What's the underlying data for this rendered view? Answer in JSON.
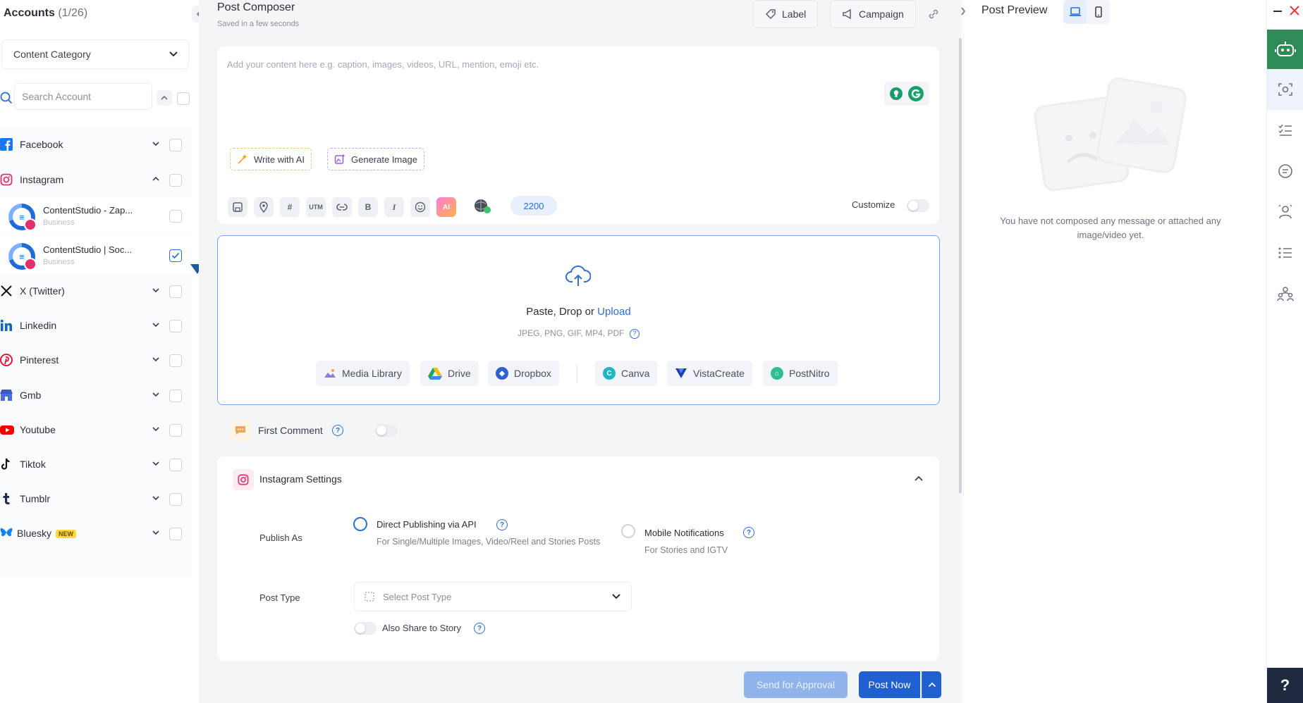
{
  "sidebar": {
    "title": "Accounts",
    "count": "(1/26)",
    "category_select": "Content Category",
    "search_placeholder": "Search Account",
    "platforms": [
      {
        "name": "Facebook"
      },
      {
        "name": "Instagram"
      },
      {
        "name": "X (Twitter)"
      },
      {
        "name": "Linkedin"
      },
      {
        "name": "Pinterest"
      },
      {
        "name": "Gmb"
      },
      {
        "name": "Youtube"
      },
      {
        "name": "Tiktok"
      },
      {
        "name": "Tumblr"
      },
      {
        "name": "Bluesky",
        "badge": "NEW"
      }
    ],
    "instagram_accounts": [
      {
        "name": "ContentStudio - Zap...",
        "type": "Business",
        "checked": false
      },
      {
        "name": "ContentStudio | Soc...",
        "type": "Business",
        "checked": true
      }
    ]
  },
  "composer": {
    "title": "Post Composer",
    "subtitle": "Saved in a few seconds",
    "label_button": "Label",
    "campaign_button": "Campaign",
    "editor_placeholder": "Add your content here e.g. caption, images, videos, URL, mention, emoji etc.",
    "write_ai": "Write with AI",
    "generate_image": "Generate Image",
    "toolbar": [
      "save",
      "location",
      "#",
      "UTM",
      "link",
      "B",
      "I",
      "emoji",
      "AI",
      "globe"
    ],
    "char_count": "2200",
    "customize": "Customize",
    "upload": {
      "main": "Paste, Drop or ",
      "link": "Upload",
      "types": "JPEG, PNG, GIF, MP4, PDF",
      "sources": [
        "Media Library",
        "Drive",
        "Dropbox",
        "Canva",
        "VistaCreate",
        "PostNitro"
      ]
    },
    "first_comment": "First Comment",
    "instagram_settings": {
      "title": "Instagram Settings",
      "publish_as_label": "Publish As",
      "option1_title": "Direct Publishing via API",
      "option1_desc": "For Single/Multiple Images, Video/Reel and Stories Posts",
      "option2_title": "Mobile Notifications",
      "option2_desc": "For Stories and IGTV",
      "post_type_label": "Post Type",
      "post_type_placeholder": "Select Post Type",
      "share_story": "Also Share to Story"
    },
    "send_approval": "Send for Approval",
    "post_now": "Post Now"
  },
  "preview": {
    "title": "Post Preview",
    "empty_message": "You have not composed any message or attached any image/video yet."
  },
  "rail": {
    "help": "?"
  },
  "colors": {
    "primary": "#1f5fd0",
    "accent_green": "#2e8a57"
  }
}
